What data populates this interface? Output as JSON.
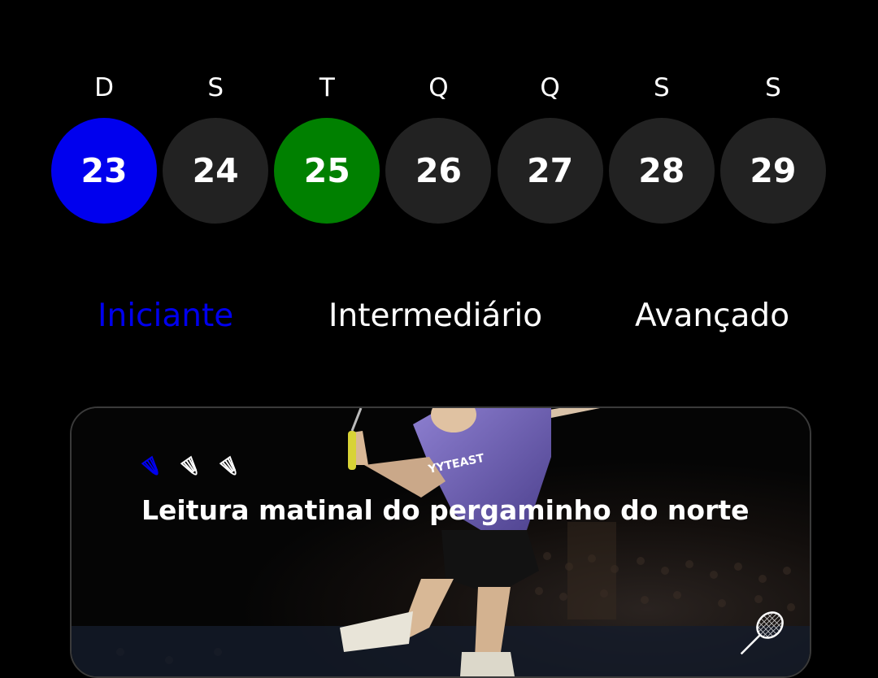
{
  "week": {
    "days": [
      {
        "letter": "D",
        "number": "23",
        "state": "selected"
      },
      {
        "letter": "S",
        "number": "24",
        "state": "default"
      },
      {
        "letter": "T",
        "number": "25",
        "state": "today"
      },
      {
        "letter": "Q",
        "number": "26",
        "state": "default"
      },
      {
        "letter": "Q",
        "number": "27",
        "state": "default"
      },
      {
        "letter": "S",
        "number": "28",
        "state": "default"
      },
      {
        "letter": "S",
        "number": "29",
        "state": "default"
      }
    ]
  },
  "levels": {
    "tabs": [
      {
        "label": "Iniciante",
        "active": true
      },
      {
        "label": "Intermediário",
        "active": false
      },
      {
        "label": "Avançado",
        "active": false
      }
    ]
  },
  "card": {
    "title": "Leitura matinal do pergaminho do norte",
    "difficulty": {
      "filled": 1,
      "total": 3
    },
    "icons": [
      "shuttlecock-icon",
      "racket-icon"
    ]
  },
  "colors": {
    "background": "#000000",
    "accent": "#0000ee",
    "today": "#008000",
    "day_default": "#222222",
    "text": "#ffffff"
  }
}
